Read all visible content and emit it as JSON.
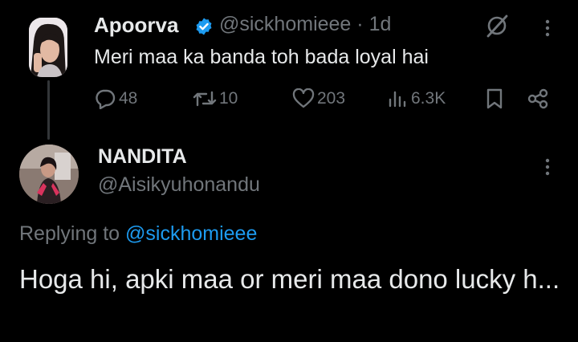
{
  "colors": {
    "background": "#000000",
    "text_primary": "#e7e9ea",
    "text_secondary": "#71767b",
    "accent": "#1d9bf0",
    "thread_line": "#333639"
  },
  "parent_tweet": {
    "display_name": "Apoorva",
    "verified_icon": "verified-badge-icon",
    "handle": "@sickhomieee",
    "separator": "·",
    "timestamp": "1d",
    "text": "Meri maa ka banda toh bada loyal hai",
    "stats": {
      "replies": "48",
      "reposts": "10",
      "likes": "203",
      "views": "6.3K"
    },
    "icons": {
      "grok": "grok-icon",
      "more": "more-vertical-icon",
      "reply": "reply-icon",
      "repost": "repost-icon",
      "like": "heart-icon",
      "views": "views-icon",
      "bookmark": "bookmark-icon",
      "share": "share-icon"
    }
  },
  "reply_tweet": {
    "display_name": "NANDITA",
    "handle": "@Aisikyuhonandu",
    "replying_prefix": "Replying to",
    "replying_to": "@sickhomieee",
    "text": "Hoga hi, apki maa or meri maa dono lucky h...",
    "icons": {
      "more": "more-vertical-icon"
    }
  }
}
